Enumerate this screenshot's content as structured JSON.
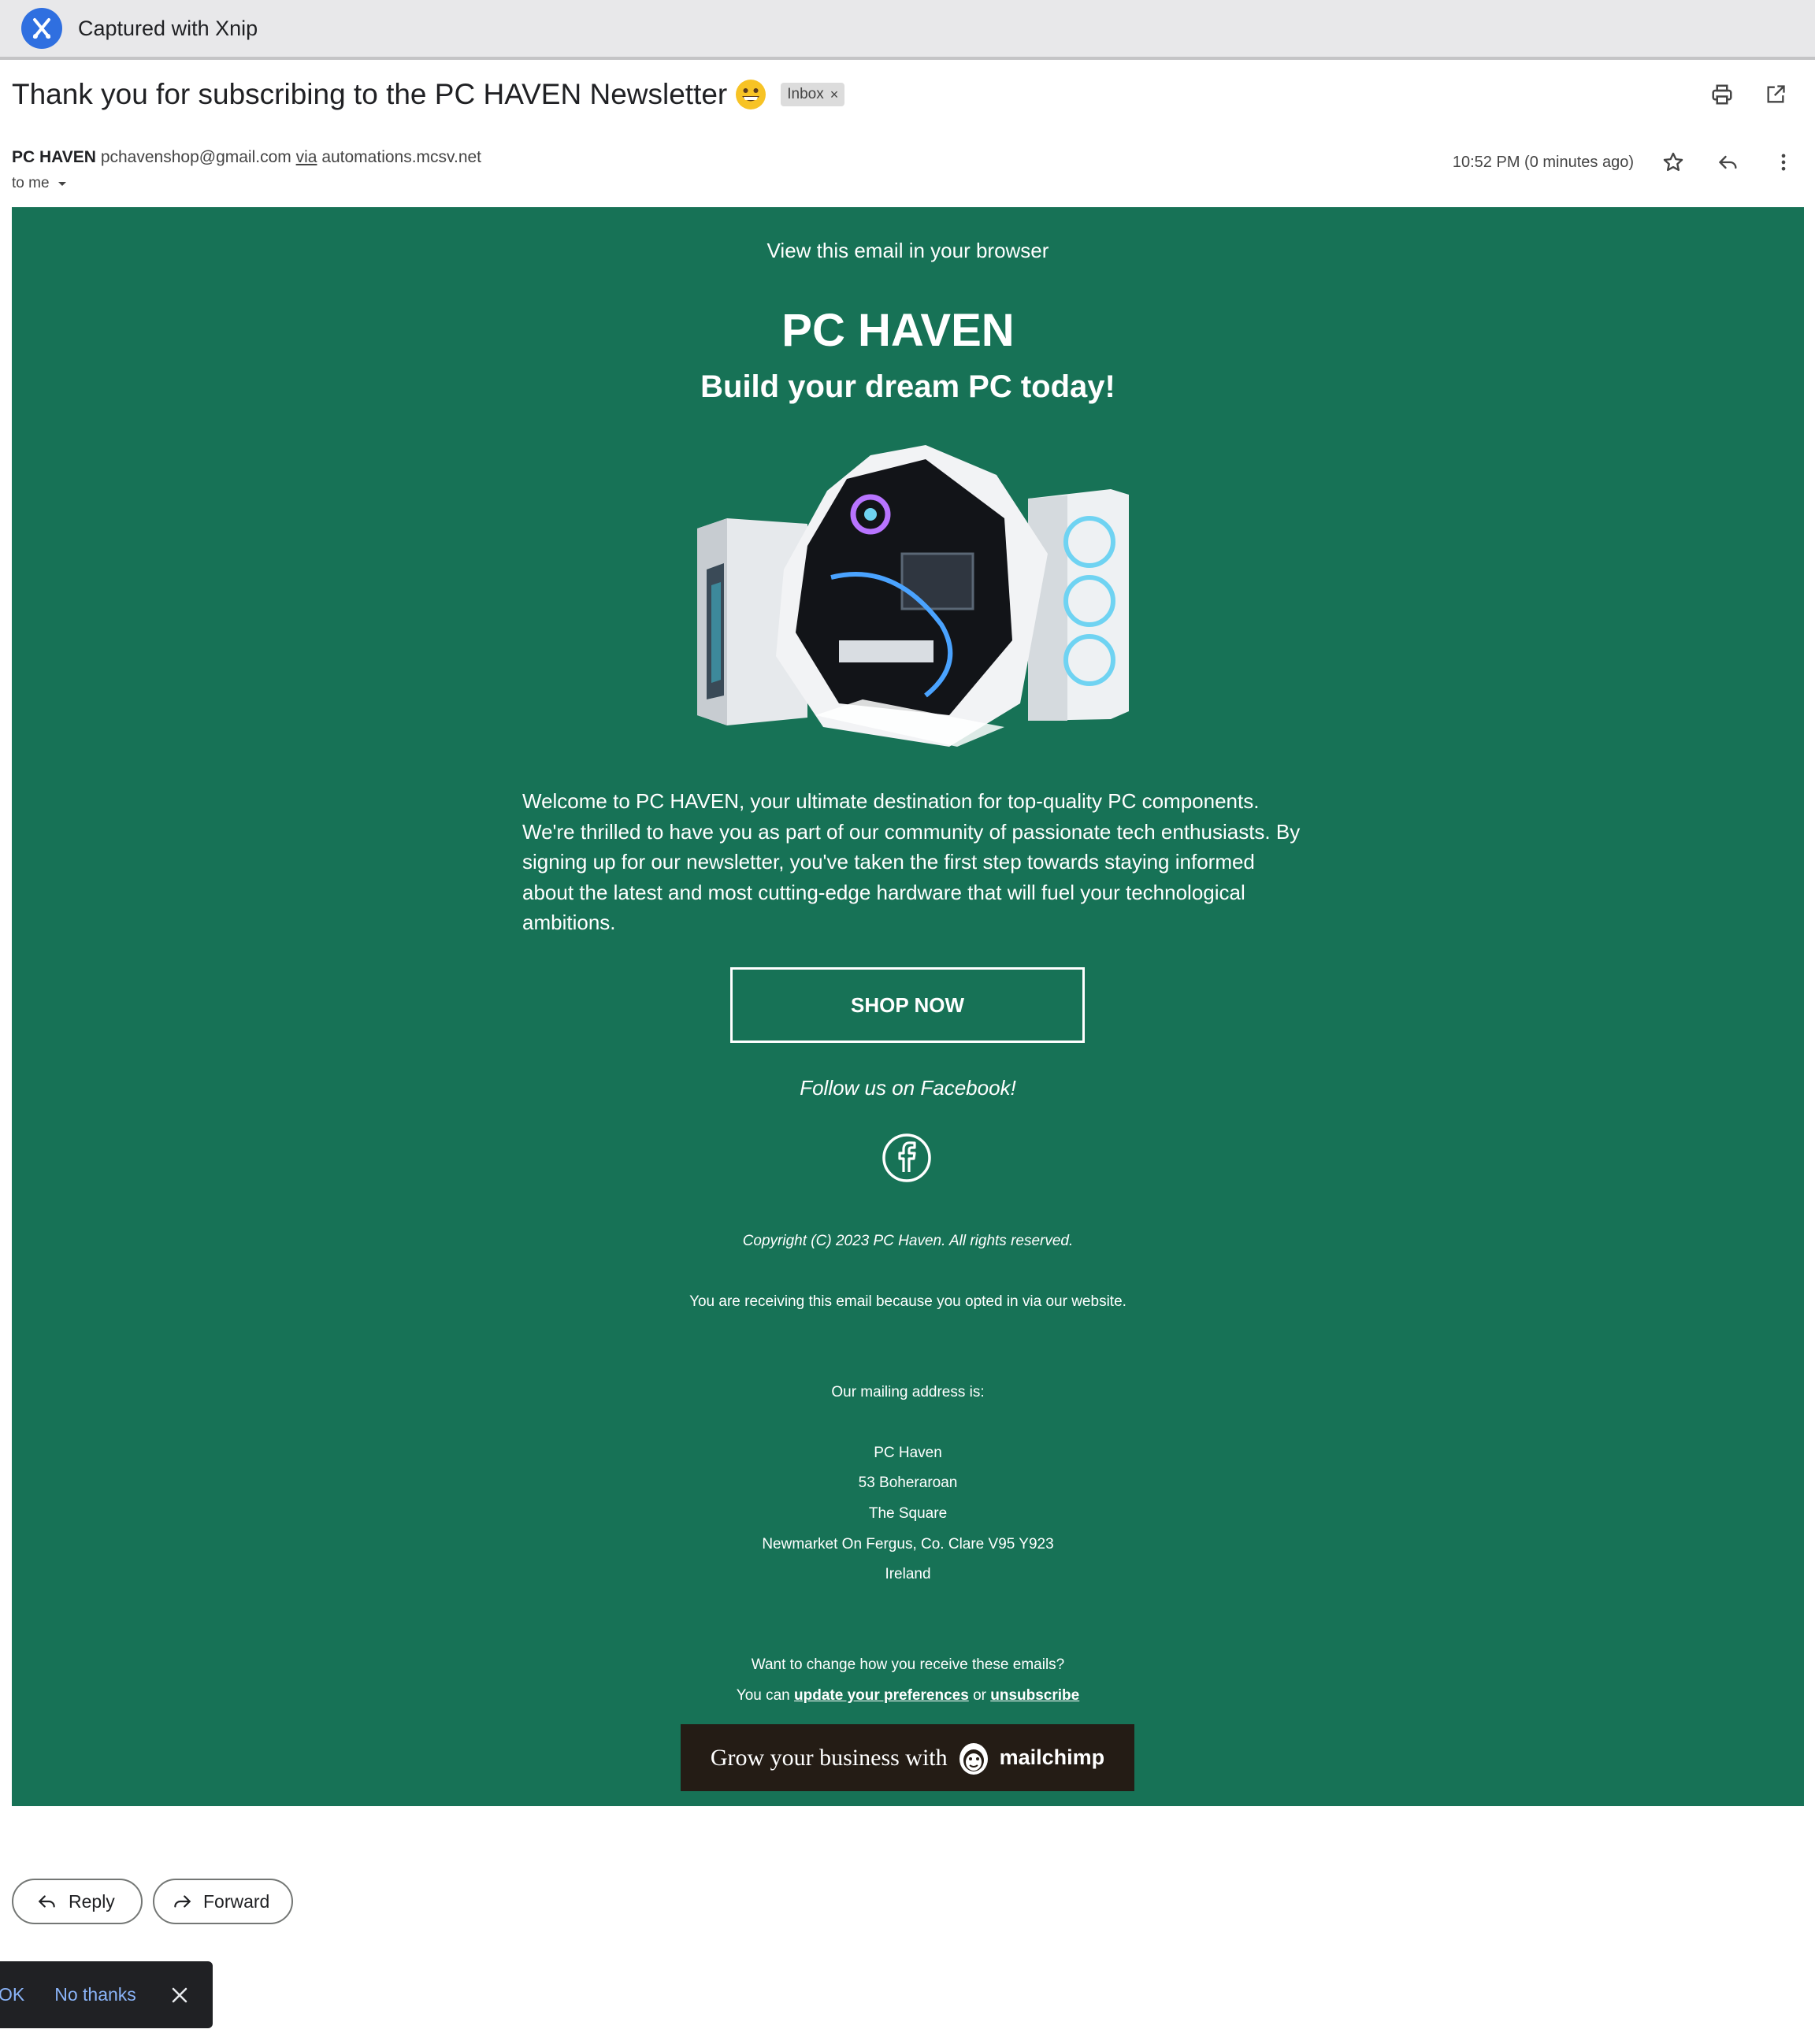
{
  "capture_bar": {
    "title": "Captured with Xnip",
    "icon": "xnip-logo-icon"
  },
  "email": {
    "subject": "Thank you for subscribing to the PC HAVEN Newsletter",
    "emoji": "😀",
    "label": "Inbox",
    "label_remove": "×",
    "sender_name": "PC HAVEN",
    "sender_email": "pchavenshop@gmail.com",
    "via_word": "via",
    "via_domain": "automations.mcsv.net",
    "recipient": "to me",
    "timestamp": "10:52 PM (0 minutes ago)",
    "actions": [
      "print-icon",
      "open-in-new-window-icon",
      "star-icon",
      "reply-icon",
      "more-vert-icon"
    ]
  },
  "newsletter": {
    "view_in_browser": "View this email in your browser",
    "brand": "PC HAVEN",
    "tagline": "Build your dream PC today!",
    "welcome_text": "Welcome to PC HAVEN, your ultimate destination for top-quality PC components. We're thrilled to have you as part of our community of passionate tech enthusiasts. By signing up for our newsletter, you've taken the first step towards staying informed about the latest and most cutting-edge hardware that will fuel your technological ambitions.",
    "shop_button": "SHOP NOW",
    "follow_text": "Follow us on Facebook!",
    "copyright": "Copyright (C) 2023 PC Haven. All rights reserved.",
    "receiving_reason": "You are receiving this email because you opted in via our website.",
    "mailing_label": "Our mailing address is:",
    "address": [
      "PC Haven",
      "53 Boheraroan",
      "The Square",
      "Newmarket On Fergus, Co. Clare V95 Y923",
      "Ireland"
    ],
    "change_question": "Want to change how you receive these emails?",
    "prefs_prefix": "You can",
    "prefs_link": "update your preferences",
    "prefs_or": "or",
    "unsubscribe_link": "unsubscribe",
    "mailchimp_text": "Grow your business with",
    "mailchimp_word": "mailchimp",
    "colors": {
      "background": "#177256",
      "text": "#ffffff",
      "mailchimp_bg": "#241c15"
    }
  },
  "footer_actions": {
    "reply": "Reply",
    "forward": "Forward"
  },
  "snackbar": {
    "ok": "OK",
    "no_thanks": "No thanks"
  }
}
